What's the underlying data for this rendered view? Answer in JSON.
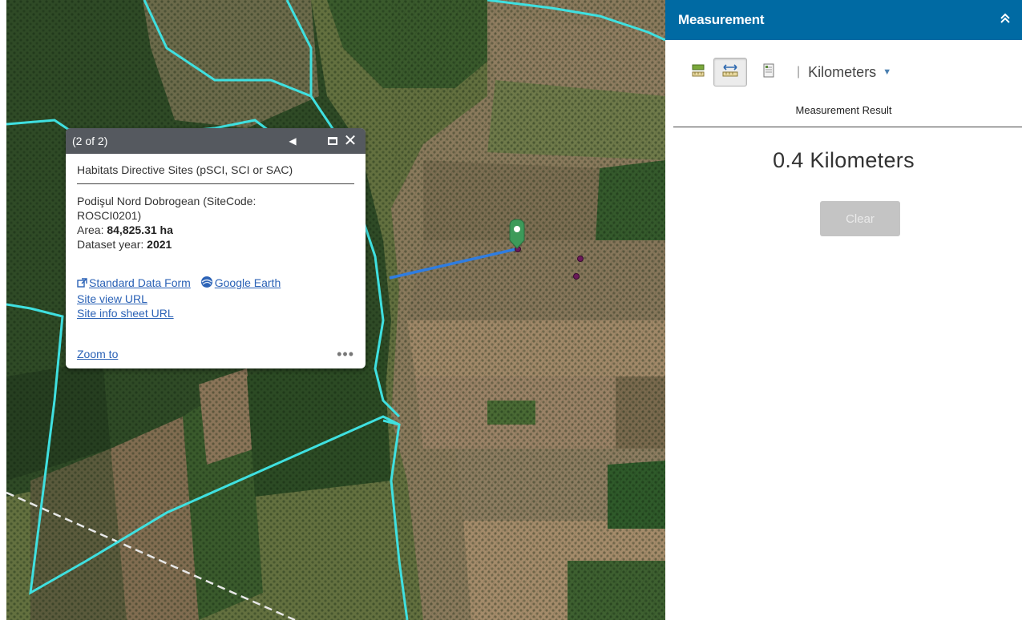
{
  "popup": {
    "count": "(2 of 2)",
    "title": "Habitats Directive Sites (pSCI, SCI or SAC)",
    "site_line1": "Podişul Nord Dobrogean  (SiteCode:",
    "site_line2": "ROSCI0201)",
    "area_label": "Area: ",
    "area_value": "84,825.31 ha",
    "year_label": "Dataset year: ",
    "year_value": "2021",
    "standard_data_form": "Standard Data Form",
    "google_earth": "Google Earth",
    "site_view_url": "Site view URL",
    "site_info_sheet_url": "Site info sheet URL",
    "zoom_to": "Zoom to",
    "more": "•••",
    "icons": {
      "prev": "triangle-left-icon",
      "maximize": "maximize-icon",
      "close": "close-icon",
      "external_link": "external-link-icon",
      "google_earth": "globe-icon"
    }
  },
  "panel": {
    "title": "Measurement",
    "collapse_icon": "double-chevron-up-icon",
    "tools": [
      "area-tool-icon",
      "distance-tool-icon",
      "location-tool-icon"
    ],
    "unit": "Kilometers",
    "result_label": "Measurement Result",
    "result": "0.4 Kilometers",
    "clear_label": "Clear",
    "header_color": "#006aa3"
  },
  "map": {
    "boundary_color": "#3fe0e0",
    "measure_line_color": "#2f7de1",
    "marker_color": "#3d9a5a"
  }
}
